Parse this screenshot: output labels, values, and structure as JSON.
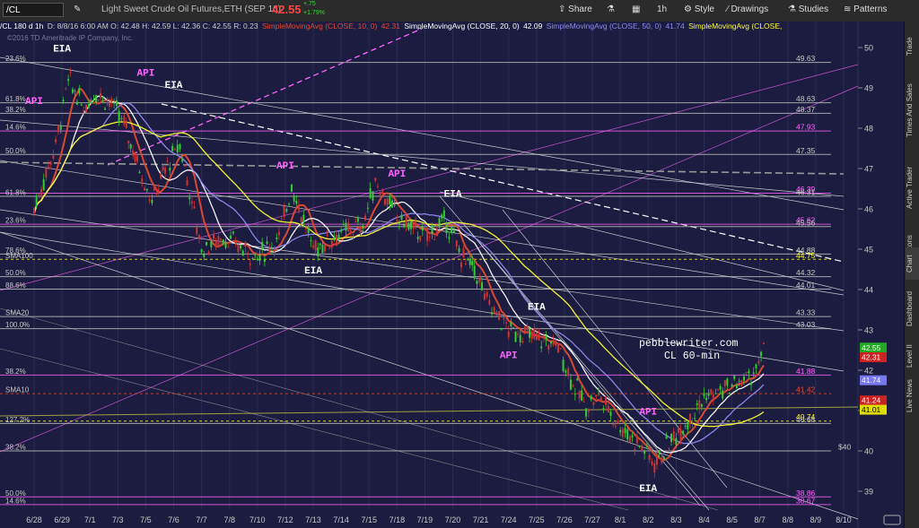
{
  "toolbar": {
    "symbol": "/CL",
    "description": "Light Sweet Crude Oil Futures,ETH (SEP 16)",
    "last_price": "42.55",
    "change_abs": "+.75",
    "change_pct": "+1.79%",
    "timeframe": "1h",
    "buttons": [
      "Share",
      "Style",
      "Drawings",
      "Studies",
      "Patterns"
    ]
  },
  "infobar": {
    "header": "/CL 180 d 1h",
    "ohlc": "D: 8/8/16 6:00 AM   O: 42.48   H: 42.59   L: 42.36   C: 42.55   R: 0.23",
    "studies": [
      {
        "label": "SimpleMovingAvg (CLOSE, 10, 0)",
        "value": "42.31",
        "color": "#e34a2f"
      },
      {
        "label": "SimpleMovingAvg (CLOSE, 20, 0)",
        "value": "42.09",
        "color": "#ffffff"
      },
      {
        "label": "SimpleMovingAvg (CLOSE, 50, 0)",
        "value": "41.74",
        "color": "#8f8cf0"
      },
      {
        "label": "SimpleMovingAvg (CLOSE,",
        "value": "",
        "color": "#ffff33"
      }
    ],
    "copyright": "©2016 TD Ameritrade IP Company, Inc."
  },
  "sidebar_tabs": [
    "Trade",
    "Times And Sales",
    "Active Trader",
    "Big Buttons",
    "Chart",
    "Dashboard",
    "Level II",
    "Live News"
  ],
  "chart_data": {
    "type": "candlestick",
    "symbol": "/CL",
    "interval": "1h",
    "x_tick_labels": [
      "6/28",
      "6/29",
      "7/1",
      "7/3",
      "7/5",
      "7/6",
      "7/7",
      "7/8",
      "7/10",
      "7/12",
      "7/13",
      "7/14",
      "7/15",
      "7/18",
      "7/19",
      "7/20",
      "7/21",
      "7/24",
      "7/25",
      "7/26",
      "7/27",
      "8/1",
      "8/2",
      "8/3",
      "8/4",
      "8/5",
      "8/7",
      "8/8",
      "8/9",
      "8/10"
    ],
    "y_tick_labels": [
      "39",
      "40",
      "41",
      "42",
      "43",
      "44",
      "45",
      "46",
      "47",
      "48",
      "49",
      "50"
    ],
    "ylim": [
      38.6,
      50.5
    ],
    "close_path": [
      [
        "6/28",
        46.0
      ],
      [
        "6/29",
        47.6
      ],
      [
        "6/29",
        49.2
      ],
      [
        "7/1",
        48.5
      ],
      [
        "7/1",
        48.9
      ],
      [
        "7/3",
        48.6
      ],
      [
        "7/3",
        48.1
      ],
      [
        "7/5",
        47.0
      ],
      [
        "7/5",
        46.2
      ],
      [
        "7/6",
        47.1
      ],
      [
        "7/6",
        47.6
      ],
      [
        "7/7",
        45.0
      ],
      [
        "7/8",
        45.3
      ],
      [
        "7/8",
        45.1
      ],
      [
        "7/10",
        44.8
      ],
      [
        "7/12",
        45.3
      ],
      [
        "7/12",
        46.6
      ],
      [
        "7/13",
        45.0
      ],
      [
        "7/14",
        45.4
      ],
      [
        "7/15",
        45.6
      ],
      [
        "7/15",
        46.7
      ],
      [
        "7/18",
        45.8
      ],
      [
        "7/19",
        45.3
      ],
      [
        "7/20",
        45.7
      ],
      [
        "7/20",
        44.9
      ],
      [
        "7/21",
        44.5
      ],
      [
        "7/21",
        43.7
      ],
      [
        "7/24",
        43.0
      ],
      [
        "7/25",
        42.8
      ],
      [
        "7/26",
        42.6
      ],
      [
        "7/26",
        41.8
      ],
      [
        "7/27",
        41.1
      ],
      [
        "7/27",
        41.4
      ],
      [
        "8/1",
        40.6
      ],
      [
        "8/2",
        40.1
      ],
      [
        "8/2",
        39.7
      ],
      [
        "8/3",
        40.4
      ],
      [
        "8/4",
        41.3
      ],
      [
        "8/5",
        41.6
      ],
      [
        "8/7",
        41.9
      ],
      [
        "8/7",
        42.55
      ]
    ],
    "moving_averages": [
      {
        "name": "SimpleMovingAvg (CLOSE, 10, 0)",
        "last": 42.31,
        "color": "#e34a2f"
      },
      {
        "name": "SimpleMovingAvg (CLOSE, 20, 0)",
        "last": 42.09,
        "color": "#ffffff"
      },
      {
        "name": "SimpleMovingAvg (CLOSE, 50, 0)",
        "last": 41.74,
        "color": "#8f8cf0"
      },
      {
        "name": "SimpleMovingAvg (CLOSE,",
        "last": 41.01,
        "color": "#ffff33"
      }
    ],
    "horizontal_levels": [
      {
        "value": 49.63,
        "label": "49.63",
        "color": "#c8c8c8"
      },
      {
        "value": 48.63,
        "label": "48.63",
        "color": "#c8c8c8"
      },
      {
        "value": 48.37,
        "label": "48.37",
        "color": "#c8c8c8"
      },
      {
        "value": 47.93,
        "label": "47.93",
        "color": "#ff66ff"
      },
      {
        "value": 47.35,
        "label": "47.35",
        "color": "#c8c8c8"
      },
      {
        "value": 46.39,
        "label": "46.39",
        "color": "#ff66ff"
      },
      {
        "value": 46.31,
        "label": "46.31",
        "color": "#c8c8c8"
      },
      {
        "value": 45.62,
        "label": "45.62",
        "color": "#ff66ff"
      },
      {
        "value": 45.56,
        "label": "45.56",
        "color": "#c8c8c8"
      },
      {
        "value": 44.88,
        "label": "44.88",
        "color": "#c8c8c8"
      },
      {
        "value": 44.75,
        "label": "44.75",
        "color": "#ffff33"
      },
      {
        "value": 44.32,
        "label": "44.32",
        "color": "#c8c8c8"
      },
      {
        "value": 44.01,
        "label": "44.01",
        "color": "#c8c8c8"
      },
      {
        "value": 43.33,
        "label": "43.33",
        "color": "#c8c8c8"
      },
      {
        "value": 43.03,
        "label": "43.03",
        "color": "#c8c8c8"
      },
      {
        "value": 41.88,
        "label": "41.88",
        "color": "#ff66ff"
      },
      {
        "value": 41.42,
        "label": "41.42",
        "color": "#e34a2f"
      },
      {
        "value": 40.74,
        "label": "40.74",
        "color": "#ffff33"
      },
      {
        "value": 40.68,
        "label": "40.68",
        "color": "#c8c8c8"
      },
      {
        "value": 40.0,
        "label": "$40",
        "color": "#c8c8c8"
      },
      {
        "value": 38.86,
        "label": "38.86",
        "color": "#ff66ff"
      },
      {
        "value": 38.67,
        "label": "38.67",
        "color": "#ff66ff"
      }
    ],
    "fib_labels": [
      {
        "label": "23.6%",
        "value": 49.63
      },
      {
        "label": "61.8%",
        "value": 48.63
      },
      {
        "label": "38.2%",
        "value": 48.37
      },
      {
        "label": "14.6%",
        "value": 47.93
      },
      {
        "label": "50.0%",
        "value": 47.35
      },
      {
        "label": "61.8%",
        "value": 46.31
      },
      {
        "label": "23.6%",
        "value": 45.62
      },
      {
        "label": "78.6%",
        "value": 44.88
      },
      {
        "label": "SMA100",
        "value": 44.75
      },
      {
        "label": "50.0%",
        "value": 44.32
      },
      {
        "label": "88.6%",
        "value": 44.01
      },
      {
        "label": "SMA20",
        "value": 43.33
      },
      {
        "label": "100.0%",
        "value": 43.03
      },
      {
        "label": "38.2%",
        "value": 41.88
      },
      {
        "label": "SMA10",
        "value": 41.42
      },
      {
        "label": "127.2%",
        "value": 40.68
      },
      {
        "label": "38.2%",
        "value": 40.0
      },
      {
        "label": "50.0%",
        "value": 38.86
      },
      {
        "label": "14.6%",
        "value": 38.67
      }
    ],
    "annotations": [
      {
        "text": "EIA",
        "x": "6/29",
        "y": 49.9,
        "color": "#ffffff"
      },
      {
        "text": "API",
        "x": "6/28",
        "y": 48.6,
        "color": "#ff66ff"
      },
      {
        "text": "API",
        "x": "7/5",
        "y": 49.3,
        "color": "#ff66ff"
      },
      {
        "text": "EIA",
        "x": "7/6",
        "y": 49.0,
        "color": "#ffffff"
      },
      {
        "text": "API",
        "x": "7/12",
        "y": 47.0,
        "color": "#ff66ff"
      },
      {
        "text": "API",
        "x": "7/18",
        "y": 46.8,
        "color": "#ff66ff"
      },
      {
        "text": "EIA",
        "x": "7/13",
        "y": 44.4,
        "color": "#ffffff"
      },
      {
        "text": "EIA",
        "x": "7/20",
        "y": 46.3,
        "color": "#ffffff"
      },
      {
        "text": "EIA",
        "x": "7/25",
        "y": 43.5,
        "color": "#ffffff"
      },
      {
        "text": "API",
        "x": "7/24",
        "y": 42.3,
        "color": "#ff66ff"
      },
      {
        "text": "API",
        "x": "8/2",
        "y": 40.9,
        "color": "#ff66ff"
      },
      {
        "text": "EIA",
        "x": "8/2",
        "y": 39.0,
        "color": "#ffffff"
      }
    ],
    "watermark": [
      "pebblewriter.com",
      "CL 60-min"
    ],
    "price_badges": [
      {
        "value": 42.55,
        "label": "42.55",
        "bg": "#22aa22",
        "fg": "#ffffff"
      },
      {
        "value": 42.31,
        "label": "42.31",
        "bg": "#cc2222",
        "fg": "#ffffff"
      },
      {
        "value": 41.74,
        "label": "41.74",
        "bg": "#7777ee",
        "fg": "#ffffff"
      },
      {
        "value": 41.24,
        "label": "41.24",
        "bg": "#cc2222",
        "fg": "#ffffff"
      },
      {
        "value": 41.01,
        "label": "41.01",
        "bg": "#dddd00",
        "fg": "#000000"
      }
    ]
  }
}
